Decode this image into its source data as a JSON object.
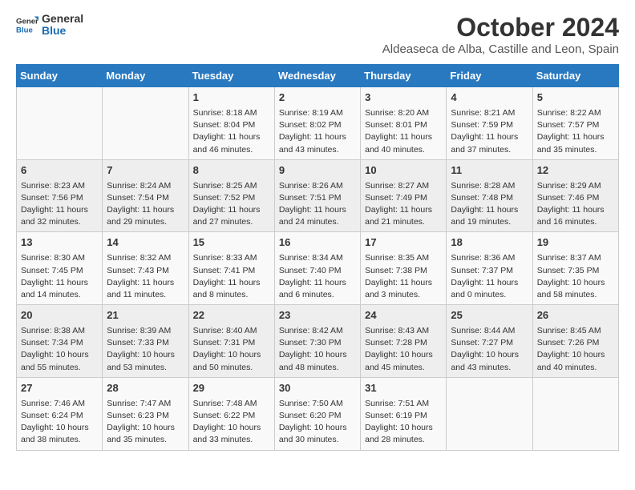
{
  "logo": {
    "line1": "General",
    "line2": "Blue"
  },
  "title": "October 2024",
  "subtitle": "Aldeaseca de Alba, Castille and Leon, Spain",
  "weekdays": [
    "Sunday",
    "Monday",
    "Tuesday",
    "Wednesday",
    "Thursday",
    "Friday",
    "Saturday"
  ],
  "rows": [
    [
      {
        "day": "",
        "content": ""
      },
      {
        "day": "",
        "content": ""
      },
      {
        "day": "1",
        "content": "Sunrise: 8:18 AM\nSunset: 8:04 PM\nDaylight: 11 hours and 46 minutes."
      },
      {
        "day": "2",
        "content": "Sunrise: 8:19 AM\nSunset: 8:02 PM\nDaylight: 11 hours and 43 minutes."
      },
      {
        "day": "3",
        "content": "Sunrise: 8:20 AM\nSunset: 8:01 PM\nDaylight: 11 hours and 40 minutes."
      },
      {
        "day": "4",
        "content": "Sunrise: 8:21 AM\nSunset: 7:59 PM\nDaylight: 11 hours and 37 minutes."
      },
      {
        "day": "5",
        "content": "Sunrise: 8:22 AM\nSunset: 7:57 PM\nDaylight: 11 hours and 35 minutes."
      }
    ],
    [
      {
        "day": "6",
        "content": "Sunrise: 8:23 AM\nSunset: 7:56 PM\nDaylight: 11 hours and 32 minutes."
      },
      {
        "day": "7",
        "content": "Sunrise: 8:24 AM\nSunset: 7:54 PM\nDaylight: 11 hours and 29 minutes."
      },
      {
        "day": "8",
        "content": "Sunrise: 8:25 AM\nSunset: 7:52 PM\nDaylight: 11 hours and 27 minutes."
      },
      {
        "day": "9",
        "content": "Sunrise: 8:26 AM\nSunset: 7:51 PM\nDaylight: 11 hours and 24 minutes."
      },
      {
        "day": "10",
        "content": "Sunrise: 8:27 AM\nSunset: 7:49 PM\nDaylight: 11 hours and 21 minutes."
      },
      {
        "day": "11",
        "content": "Sunrise: 8:28 AM\nSunset: 7:48 PM\nDaylight: 11 hours and 19 minutes."
      },
      {
        "day": "12",
        "content": "Sunrise: 8:29 AM\nSunset: 7:46 PM\nDaylight: 11 hours and 16 minutes."
      }
    ],
    [
      {
        "day": "13",
        "content": "Sunrise: 8:30 AM\nSunset: 7:45 PM\nDaylight: 11 hours and 14 minutes."
      },
      {
        "day": "14",
        "content": "Sunrise: 8:32 AM\nSunset: 7:43 PM\nDaylight: 11 hours and 11 minutes."
      },
      {
        "day": "15",
        "content": "Sunrise: 8:33 AM\nSunset: 7:41 PM\nDaylight: 11 hours and 8 minutes."
      },
      {
        "day": "16",
        "content": "Sunrise: 8:34 AM\nSunset: 7:40 PM\nDaylight: 11 hours and 6 minutes."
      },
      {
        "day": "17",
        "content": "Sunrise: 8:35 AM\nSunset: 7:38 PM\nDaylight: 11 hours and 3 minutes."
      },
      {
        "day": "18",
        "content": "Sunrise: 8:36 AM\nSunset: 7:37 PM\nDaylight: 11 hours and 0 minutes."
      },
      {
        "day": "19",
        "content": "Sunrise: 8:37 AM\nSunset: 7:35 PM\nDaylight: 10 hours and 58 minutes."
      }
    ],
    [
      {
        "day": "20",
        "content": "Sunrise: 8:38 AM\nSunset: 7:34 PM\nDaylight: 10 hours and 55 minutes."
      },
      {
        "day": "21",
        "content": "Sunrise: 8:39 AM\nSunset: 7:33 PM\nDaylight: 10 hours and 53 minutes."
      },
      {
        "day": "22",
        "content": "Sunrise: 8:40 AM\nSunset: 7:31 PM\nDaylight: 10 hours and 50 minutes."
      },
      {
        "day": "23",
        "content": "Sunrise: 8:42 AM\nSunset: 7:30 PM\nDaylight: 10 hours and 48 minutes."
      },
      {
        "day": "24",
        "content": "Sunrise: 8:43 AM\nSunset: 7:28 PM\nDaylight: 10 hours and 45 minutes."
      },
      {
        "day": "25",
        "content": "Sunrise: 8:44 AM\nSunset: 7:27 PM\nDaylight: 10 hours and 43 minutes."
      },
      {
        "day": "26",
        "content": "Sunrise: 8:45 AM\nSunset: 7:26 PM\nDaylight: 10 hours and 40 minutes."
      }
    ],
    [
      {
        "day": "27",
        "content": "Sunrise: 7:46 AM\nSunset: 6:24 PM\nDaylight: 10 hours and 38 minutes."
      },
      {
        "day": "28",
        "content": "Sunrise: 7:47 AM\nSunset: 6:23 PM\nDaylight: 10 hours and 35 minutes."
      },
      {
        "day": "29",
        "content": "Sunrise: 7:48 AM\nSunset: 6:22 PM\nDaylight: 10 hours and 33 minutes."
      },
      {
        "day": "30",
        "content": "Sunrise: 7:50 AM\nSunset: 6:20 PM\nDaylight: 10 hours and 30 minutes."
      },
      {
        "day": "31",
        "content": "Sunrise: 7:51 AM\nSunset: 6:19 PM\nDaylight: 10 hours and 28 minutes."
      },
      {
        "day": "",
        "content": ""
      },
      {
        "day": "",
        "content": ""
      }
    ]
  ]
}
